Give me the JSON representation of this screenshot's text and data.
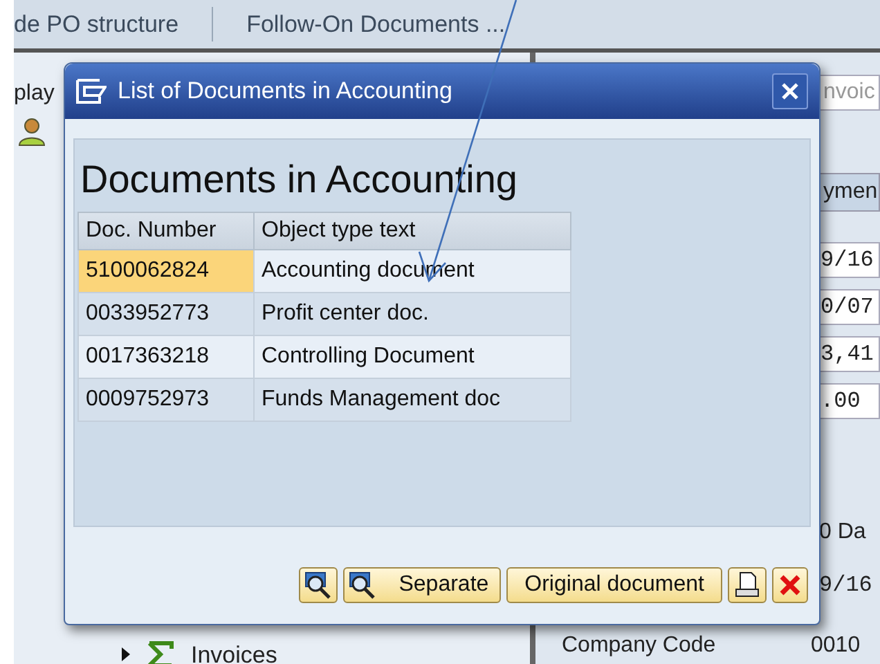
{
  "background": {
    "toolbar": [
      "de PO structure",
      "Follow-On Documents ..."
    ],
    "left_pane": {
      "tab_fragment": "play",
      "tree_item": "Invoices"
    },
    "right_pane": {
      "field_fragment": "nvoic",
      "tab_fragment": "ymen",
      "values": [
        "9/16",
        "0/07",
        "3,41",
        ".00"
      ],
      "lines": [
        "0 Da",
        "9/16"
      ],
      "company_code": {
        "label": "Company Code",
        "value": "0010"
      }
    }
  },
  "dialog": {
    "title": "List of Documents in Accounting",
    "heading": "Documents in Accounting",
    "columns": [
      "Doc. Number",
      "Object type text"
    ],
    "rows": [
      {
        "doc_number": "5100062824",
        "object_type": "Accounting document",
        "selected": true
      },
      {
        "doc_number": "0033952773",
        "object_type": "Profit center doc.",
        "selected": false
      },
      {
        "doc_number": "0017363218",
        "object_type": "Controlling Document",
        "selected": false
      },
      {
        "doc_number": "0009752973",
        "object_type": "Funds Management doc",
        "selected": false
      }
    ],
    "buttons": [
      {
        "kind": "detail"
      },
      {
        "kind": "detail",
        "label": "Separate"
      },
      {
        "kind": "text",
        "label": "Original document"
      },
      {
        "kind": "print"
      },
      {
        "kind": "cancel"
      }
    ]
  }
}
